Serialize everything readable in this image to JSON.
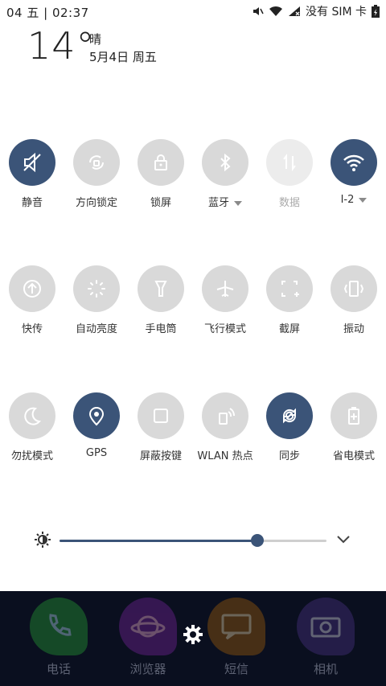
{
  "status_bar": {
    "left_text": "04 五 | 02:37",
    "carrier": "没有 SIM 卡"
  },
  "weather": {
    "temperature": "14°",
    "condition": "晴",
    "date": "5月4日 周五"
  },
  "toggles": [
    {
      "label": "静音",
      "icon": "mute-icon",
      "state": "on"
    },
    {
      "label": "方向锁定",
      "icon": "rotation-lock-icon",
      "state": "off"
    },
    {
      "label": "锁屏",
      "icon": "lock-icon",
      "state": "off"
    },
    {
      "label": "蓝牙",
      "icon": "bluetooth-icon",
      "state": "off",
      "dropdown": true
    },
    {
      "label": "数据",
      "icon": "mobile-data-icon",
      "state": "disabled"
    },
    {
      "label": "I-2",
      "icon": "wifi-icon",
      "state": "on",
      "dropdown": true
    },
    {
      "label": "快传",
      "icon": "quick-share-icon",
      "state": "off"
    },
    {
      "label": "自动亮度",
      "icon": "auto-brightness-icon",
      "state": "off"
    },
    {
      "label": "手电筒",
      "icon": "flashlight-icon",
      "state": "off"
    },
    {
      "label": "飞行模式",
      "icon": "airplane-icon",
      "state": "off"
    },
    {
      "label": "截屏",
      "icon": "screenshot-icon",
      "state": "off"
    },
    {
      "label": "振动",
      "icon": "vibrate-icon",
      "state": "off"
    },
    {
      "label": "勿扰模式",
      "icon": "moon-icon",
      "state": "off"
    },
    {
      "label": "GPS",
      "icon": "location-pin-icon",
      "state": "on"
    },
    {
      "label": "屏蔽按键",
      "icon": "block-keys-icon",
      "state": "off"
    },
    {
      "label": "WLAN 热点",
      "icon": "hotspot-icon",
      "state": "off"
    },
    {
      "label": "同步",
      "icon": "sync-icon",
      "state": "on"
    },
    {
      "label": "省电模式",
      "icon": "battery-saver-icon",
      "state": "off"
    }
  ],
  "brightness": {
    "level": 0.74
  },
  "dock": {
    "apps": [
      {
        "label": "电话",
        "icon": "phone-icon",
        "color": "#1f7a2e"
      },
      {
        "label": "浏览器",
        "icon": "browser-icon",
        "color": "#5a1f7a"
      },
      {
        "label": "短信",
        "icon": "message-icon",
        "color": "#7a4a10"
      },
      {
        "label": "相机",
        "icon": "camera-icon",
        "color": "#3a2a6a"
      }
    ]
  },
  "colors": {
    "accent": "#3b5478",
    "tile_off": "#d9d9d9"
  }
}
